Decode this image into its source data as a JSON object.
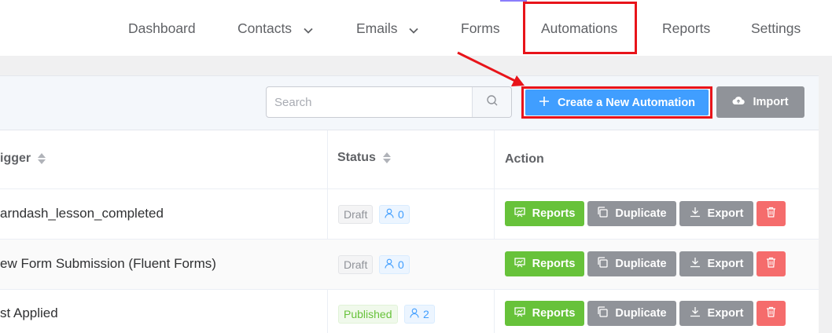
{
  "nav": {
    "items": [
      {
        "label": "Dashboard",
        "has_chevron": false
      },
      {
        "label": "Contacts",
        "has_chevron": true
      },
      {
        "label": "Emails",
        "has_chevron": true
      },
      {
        "label": "Forms",
        "has_chevron": false
      },
      {
        "label": "Automations",
        "has_chevron": false,
        "active": true
      },
      {
        "label": "Reports",
        "has_chevron": false
      },
      {
        "label": "Settings",
        "has_chevron": false
      }
    ]
  },
  "toolbar": {
    "search_placeholder": "Search",
    "create_label": "Create a New Automation",
    "import_label": "Import"
  },
  "table": {
    "headers": {
      "trigger": "igger",
      "status": "Status",
      "action": "Action"
    },
    "rows": [
      {
        "trigger": "arndash_lesson_completed",
        "status": "Draft",
        "count": "0"
      },
      {
        "trigger": "ew Form Submission (Fluent Forms)",
        "status": "Draft",
        "count": "0"
      },
      {
        "trigger": "st Applied",
        "status": "Published",
        "count": "2"
      }
    ],
    "actions": {
      "reports": "Reports",
      "duplicate": "Duplicate",
      "export": "Export"
    }
  },
  "colors": {
    "primary": "#409eff",
    "success": "#67c23a",
    "info": "#909399",
    "danger": "#f56c6c",
    "highlight": "#e8141a"
  },
  "icons": {
    "search": "search-icon",
    "plus": "plus-icon",
    "import": "cloud-upload-icon",
    "reports": "chart-board-icon",
    "duplicate": "copy-icon",
    "export": "download-icon",
    "delete": "trash-icon",
    "user": "user-icon",
    "sort": "sort-icon",
    "chevron": "chevron-down-icon"
  }
}
